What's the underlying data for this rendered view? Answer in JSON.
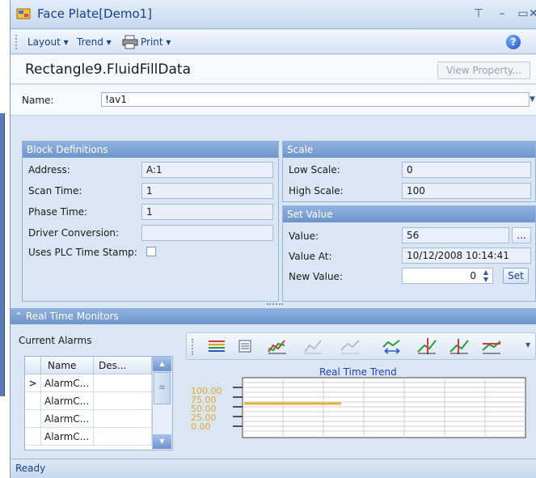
{
  "window": {
    "title": "Face Plate[Demo1]"
  },
  "menu": {
    "layout": "Layout ▾",
    "trend": "Trend ▾",
    "print": "Print ▾",
    "help": "?"
  },
  "header": {
    "title": "Rectangle9.FluidFillData",
    "view_property": "View Property..."
  },
  "name_field": {
    "label": "Name:",
    "value": "!av1"
  },
  "block_definitions": {
    "title": "Block Definitions",
    "rows": [
      {
        "label": "Address:",
        "value": "A:1"
      },
      {
        "label": "Scan Time:",
        "value": "1"
      },
      {
        "label": "Phase Time:",
        "value": "1"
      },
      {
        "label": "Driver Conversion:",
        "value": ""
      },
      {
        "label": "Uses PLC Time Stamp:",
        "value": ""
      }
    ]
  },
  "scale": {
    "title": "Scale",
    "rows": [
      {
        "label": "Low Scale:",
        "value": "0"
      },
      {
        "label": "High Scale:",
        "value": "100"
      }
    ]
  },
  "set_value": {
    "title": "Set Value",
    "value_label": "Value:",
    "value": "56",
    "browse": "...",
    "value_at_label": "Value At:",
    "value_at": "10/12/2008 10:14:41",
    "new_value_label": "New Value:",
    "new_value": "0",
    "set_button": "Set"
  },
  "real_time_monitors": {
    "title": "Real Time Monitors",
    "collapse_icon": "double-chevron-up-icon",
    "alarms_title": "Current Alarms",
    "columns": [
      "Name",
      "Des..."
    ],
    "rows": [
      "AlarmC...",
      "AlarmC...",
      "AlarmC...",
      "AlarmC..."
    ],
    "current_row_marker": ">"
  },
  "trend": {
    "title": "Real Time Trend",
    "y_labels": [
      "100.00",
      "75.00",
      "50.00",
      "25.00",
      "0.00"
    ],
    "line_color": "#e4b53a"
  },
  "status": "Ready"
}
